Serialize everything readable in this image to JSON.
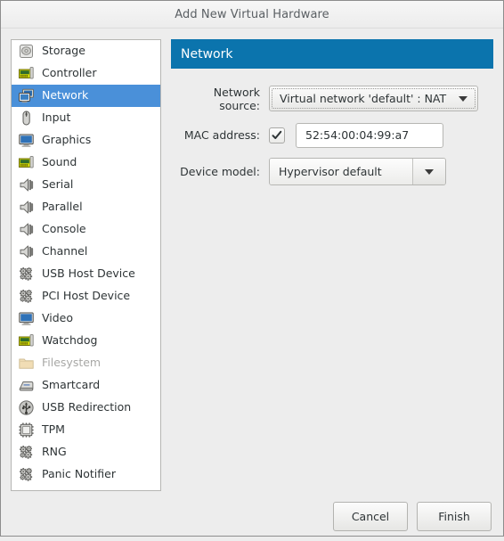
{
  "window": {
    "title": "Add New Virtual Hardware"
  },
  "sidebar": {
    "items": [
      {
        "label": "Storage",
        "icon": "disk-icon",
        "selected": false,
        "disabled": false
      },
      {
        "label": "Controller",
        "icon": "controller-card-icon",
        "selected": false,
        "disabled": false
      },
      {
        "label": "Network",
        "icon": "network-icon",
        "selected": true,
        "disabled": false
      },
      {
        "label": "Input",
        "icon": "mouse-icon",
        "selected": false,
        "disabled": false
      },
      {
        "label": "Graphics",
        "icon": "monitor-icon",
        "selected": false,
        "disabled": false
      },
      {
        "label": "Sound",
        "icon": "sound-card-icon",
        "selected": false,
        "disabled": false
      },
      {
        "label": "Serial",
        "icon": "plug-icon",
        "selected": false,
        "disabled": false
      },
      {
        "label": "Parallel",
        "icon": "plug-icon",
        "selected": false,
        "disabled": false
      },
      {
        "label": "Console",
        "icon": "plug-icon",
        "selected": false,
        "disabled": false
      },
      {
        "label": "Channel",
        "icon": "plug-icon",
        "selected": false,
        "disabled": false
      },
      {
        "label": "USB Host Device",
        "icon": "gears-icon",
        "selected": false,
        "disabled": false
      },
      {
        "label": "PCI Host Device",
        "icon": "gears-icon",
        "selected": false,
        "disabled": false
      },
      {
        "label": "Video",
        "icon": "monitor-icon",
        "selected": false,
        "disabled": false
      },
      {
        "label": "Watchdog",
        "icon": "watchdog-card-icon",
        "selected": false,
        "disabled": false
      },
      {
        "label": "Filesystem",
        "icon": "folder-icon",
        "selected": false,
        "disabled": true
      },
      {
        "label": "Smartcard",
        "icon": "smartcard-icon",
        "selected": false,
        "disabled": false
      },
      {
        "label": "USB Redirection",
        "icon": "usb-icon",
        "selected": false,
        "disabled": false
      },
      {
        "label": "TPM",
        "icon": "chip-icon",
        "selected": false,
        "disabled": false
      },
      {
        "label": "RNG",
        "icon": "gears-icon",
        "selected": false,
        "disabled": false
      },
      {
        "label": "Panic Notifier",
        "icon": "gears-icon",
        "selected": false,
        "disabled": false
      }
    ]
  },
  "pane": {
    "header": "Network",
    "fields": {
      "network_source": {
        "label": "Network source:",
        "value": "Virtual network 'default' : NAT"
      },
      "mac_address": {
        "label": "MAC address:",
        "checked": true,
        "value": "52:54:00:04:99:a7"
      },
      "device_model": {
        "label": "Device model:",
        "value": "Hypervisor default"
      }
    }
  },
  "footer": {
    "cancel_label": "Cancel",
    "finish_label": "Finish"
  },
  "colors": {
    "selection_blue": "#4a90d9",
    "header_blue": "#0b74ad",
    "window_bg": "#ededed"
  }
}
